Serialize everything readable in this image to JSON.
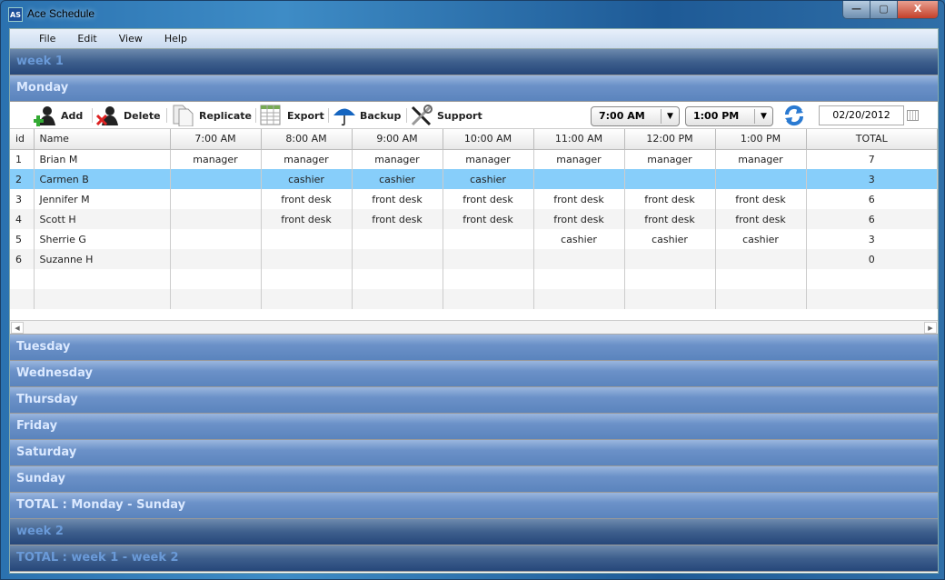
{
  "window": {
    "title": "Ace Schedule",
    "icon_text": "AS",
    "controls": [
      "—",
      "▢",
      "X"
    ]
  },
  "menu": [
    "File",
    "Edit",
    "View",
    "Help"
  ],
  "week1": "week 1",
  "monday": "Monday",
  "toolbar": {
    "add": "Add",
    "delete": "Delete",
    "replicate": "Replicate",
    "export": "Export",
    "backup": "Backup",
    "support": "Support",
    "start_time": "7:00 AM",
    "end_time": "1:00 PM",
    "date": "02/20/2012"
  },
  "grid": {
    "columns": [
      "id",
      "Name",
      "7:00 AM",
      "8:00 AM",
      "9:00 AM",
      "10:00 AM",
      "11:00 AM",
      "12:00 PM",
      "1:00 PM",
      "TOTAL"
    ],
    "rows": [
      [
        "1",
        "Brian M",
        "manager",
        "manager",
        "manager",
        "manager",
        "manager",
        "manager",
        "manager",
        "7"
      ],
      [
        "2",
        "Carmen B",
        "",
        "cashier",
        "cashier",
        "cashier",
        "",
        "",
        "",
        "3"
      ],
      [
        "3",
        "Jennifer M",
        "",
        "front desk",
        "front desk",
        "front desk",
        "front desk",
        "front desk",
        "front desk",
        "6"
      ],
      [
        "4",
        "Scott H",
        "",
        "front desk",
        "front desk",
        "front desk",
        "front desk",
        "front desk",
        "front desk",
        "6"
      ],
      [
        "5",
        "Sherrie G",
        "",
        "",
        "",
        "",
        "cashier",
        "cashier",
        "cashier",
        "3"
      ],
      [
        "6",
        "Suzanne H",
        "",
        "",
        "",
        "",
        "",
        "",
        "",
        "0"
      ]
    ],
    "selected_row": 1
  },
  "days": [
    "Tuesday",
    "Wednesday",
    "Thursday",
    "Friday",
    "Saturday",
    "Sunday",
    "TOTAL : Monday - Sunday"
  ],
  "week2": "week 2",
  "total_weeks": "TOTAL : week 1 - week 2"
}
